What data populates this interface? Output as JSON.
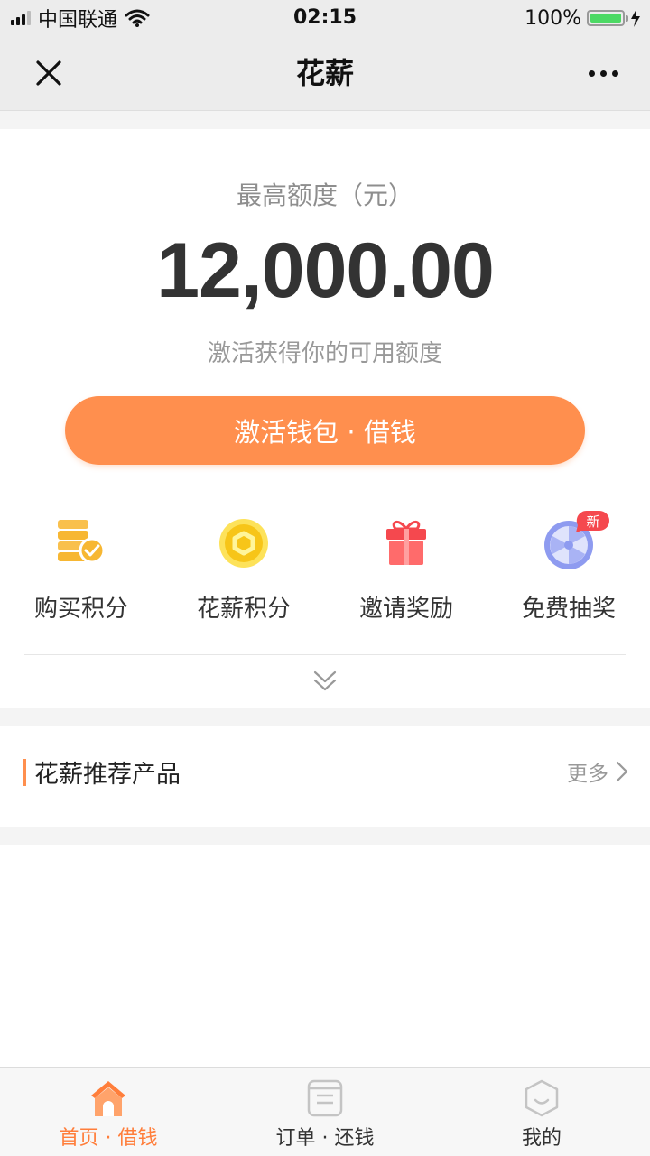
{
  "status_bar": {
    "carrier": "中国联通",
    "time": "02:15",
    "battery": "100%"
  },
  "nav": {
    "title": "花薪"
  },
  "hero": {
    "limit_label": "最高额度（元）",
    "limit_amount": "12,000.00",
    "hint": "激活获得你的可用额度",
    "activate_label": "激活钱包 · 借钱"
  },
  "features": [
    {
      "label": "购买积分",
      "icon": "points-card-icon"
    },
    {
      "label": "花薪积分",
      "icon": "coin-icon"
    },
    {
      "label": "邀请奖励",
      "icon": "gift-icon"
    },
    {
      "label": "免费抽奖",
      "icon": "lottery-wheel-icon",
      "badge": "新"
    }
  ],
  "recommend": {
    "title": "花薪推荐产品",
    "more": "更多"
  },
  "tabs": [
    {
      "label": "首页 · 借钱",
      "icon": "home-icon",
      "active": true
    },
    {
      "label": "订单 · 还钱",
      "icon": "order-icon",
      "active": false
    },
    {
      "label": "我的",
      "icon": "profile-icon",
      "active": false
    }
  ],
  "colors": {
    "accent": "#ff8f4e",
    "tab_active": "#ff7e3b",
    "badge": "#f5484e"
  }
}
